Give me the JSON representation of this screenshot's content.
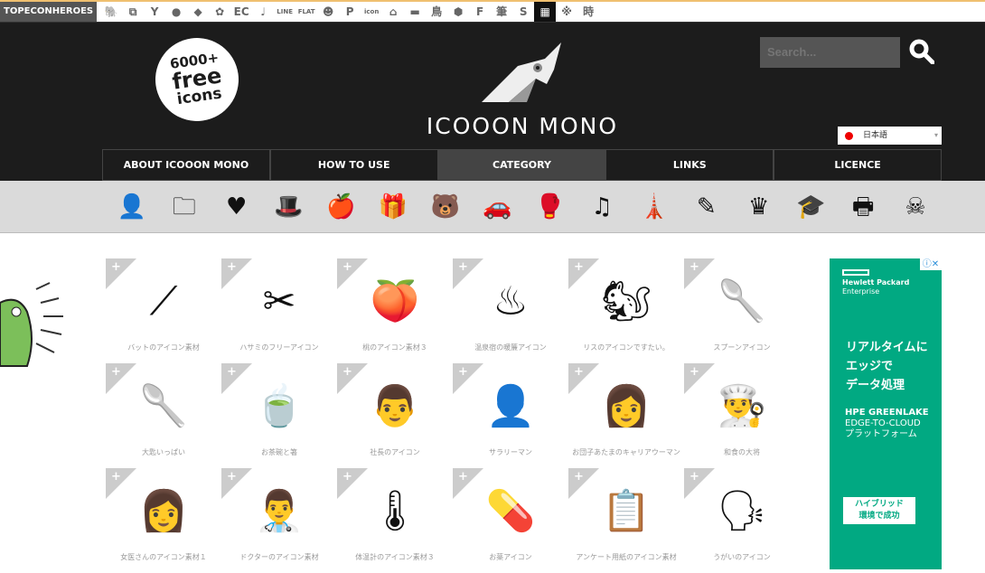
{
  "topbar": {
    "brand": "TOPECONHEROES",
    "items": [
      "🐘",
      "⧉",
      "Y",
      "●",
      "◆",
      "✿",
      "EC",
      "♩",
      "LINE",
      "FLAT",
      "☻",
      "P",
      "icon",
      "⌂",
      "▬",
      "鳥",
      "⬢",
      "F",
      "筆",
      "S",
      "▦",
      "※",
      "時"
    ],
    "active_index": 20
  },
  "header": {
    "badge": [
      "6000+",
      "free",
      "icons"
    ],
    "site_title": "ICOOON MONO",
    "search_placeholder": "Search...",
    "language": "日本語"
  },
  "nav": [
    {
      "label": "ABOUT ICOOON MONO"
    },
    {
      "label": "HOW TO USE"
    },
    {
      "label": "CATEGORY",
      "active": true
    },
    {
      "label": "LINKS"
    },
    {
      "label": "LICENCE"
    }
  ],
  "categories": [
    "person",
    "folder",
    "heart-syringe",
    "hat",
    "apple",
    "gift",
    "bear",
    "car",
    "boxing-glove",
    "music",
    "lighthouse",
    "pencil",
    "crown-badge",
    "graduation-cap",
    "printer",
    "pirate-skull"
  ],
  "category_glyphs": [
    "👤",
    "🗀",
    "♥",
    "🎩",
    "🍎",
    "🎁",
    "🐻",
    "🚗",
    "🥊",
    "♫",
    "🗼",
    "✎",
    "♛",
    "🎓",
    "🖶",
    "☠"
  ],
  "icons": [
    {
      "label": "バットのアイコン素材",
      "glyph": "⟋"
    },
    {
      "label": "ハサミのフリーアイコン",
      "glyph": "✂"
    },
    {
      "label": "桃のアイコン素材３",
      "glyph": "🍑"
    },
    {
      "label": "温泉宿の暖簾アイコン",
      "glyph": "♨"
    },
    {
      "label": "リスのアイコンですたい。",
      "glyph": "🐿"
    },
    {
      "label": "スプーンアイコン",
      "glyph": "🥄"
    },
    {
      "label": "大匙いっぱい",
      "glyph": "🥄"
    },
    {
      "label": "お茶碗と箸",
      "glyph": "🍵"
    },
    {
      "label": "社長のアイコン",
      "glyph": "👨"
    },
    {
      "label": "サラリーマン",
      "glyph": "👤"
    },
    {
      "label": "お団子あたまのキャリアウーマン",
      "glyph": "👩"
    },
    {
      "label": "和食の大将",
      "glyph": "👨‍🍳"
    },
    {
      "label": "女医さんのアイコン素材１",
      "glyph": "👩"
    },
    {
      "label": "ドクターのアイコン素材",
      "glyph": "👨‍⚕"
    },
    {
      "label": "体温計のアイコン素材３",
      "glyph": "🌡"
    },
    {
      "label": "お薬アイコン",
      "glyph": "💊"
    },
    {
      "label": "アンケート用紙のアイコン素材",
      "glyph": "📋"
    },
    {
      "label": "うがいのアイコン",
      "glyph": "🗣"
    }
  ],
  "ad": {
    "controls": "ⓘ✕",
    "brand": [
      "Hewlett Packard",
      "Enterprise"
    ],
    "headline": [
      "リアルタイムに",
      "エッジで",
      "データ処理"
    ],
    "sub": [
      "HPE GREENLAKE",
      "EDGE-TO-CLOUD",
      "プラットフォーム"
    ],
    "cta": [
      "ハイブリッド",
      "環境で成功"
    ],
    "color": "#01a982"
  }
}
